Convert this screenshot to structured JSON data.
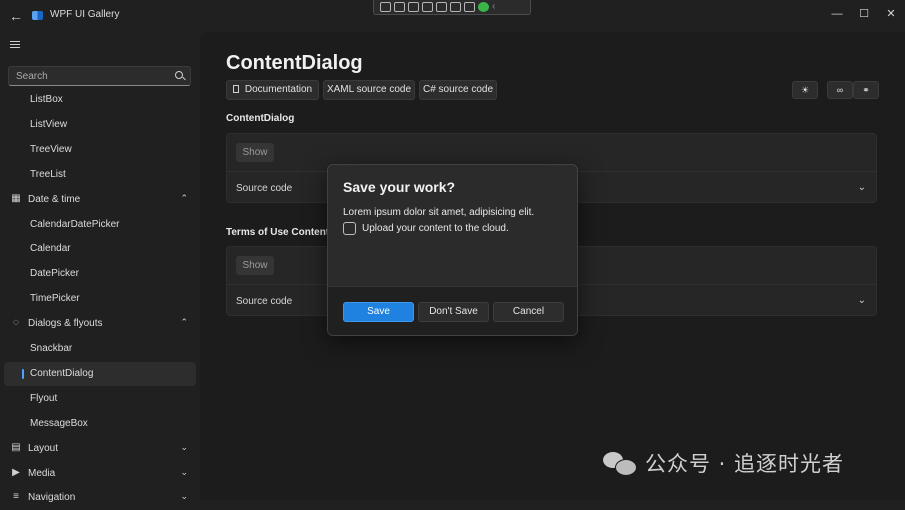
{
  "titlebar": {
    "app_title": "WPF UI Gallery",
    "back_icon": "arrow-left-icon",
    "window_controls": {
      "minimize": "—",
      "maximize": "☐",
      "close": "✕"
    }
  },
  "search": {
    "placeholder": "Search"
  },
  "nav": {
    "items": [
      {
        "label": "ListBox",
        "kind": "sub"
      },
      {
        "label": "ListView",
        "kind": "sub"
      },
      {
        "label": "TreeView",
        "kind": "sub"
      },
      {
        "label": "TreeList",
        "kind": "sub"
      },
      {
        "label": "Date & time",
        "kind": "group",
        "icon": "calendar-clock-icon",
        "chevron": "⌃"
      },
      {
        "label": "CalendarDatePicker",
        "kind": "sub"
      },
      {
        "label": "Calendar",
        "kind": "sub"
      },
      {
        "label": "DatePicker",
        "kind": "sub"
      },
      {
        "label": "TimePicker",
        "kind": "sub"
      },
      {
        "label": "Dialogs & flyouts",
        "kind": "group",
        "icon": "chat-bubble-icon",
        "chevron": "⌃"
      },
      {
        "label": "Snackbar",
        "kind": "sub"
      },
      {
        "label": "ContentDialog",
        "kind": "sub",
        "active": true
      },
      {
        "label": "Flyout",
        "kind": "sub"
      },
      {
        "label": "MessageBox",
        "kind": "sub"
      },
      {
        "label": "Layout",
        "kind": "group",
        "icon": "layout-icon",
        "chevron": "⌄"
      },
      {
        "label": "Media",
        "kind": "group",
        "icon": "play-circle-icon",
        "chevron": "⌄"
      },
      {
        "label": "Navigation",
        "kind": "group",
        "icon": "menu-lines-icon",
        "chevron": "⌄"
      }
    ]
  },
  "main": {
    "title": "ContentDialog",
    "buttons": {
      "documentation": "Documentation",
      "xaml": "XAML source code",
      "csharp": "C# source code"
    },
    "icon_buttons": {
      "theme": "☀",
      "link": "∞",
      "link2": "⚭"
    },
    "sections": [
      {
        "heading": "ContentDialog",
        "show_label": "Show",
        "source_label": "Source code",
        "chevron": "⌄"
      },
      {
        "heading": "Terms of Use ContentDialog",
        "show_label": "Show",
        "source_label": "Source code",
        "chevron": "⌄"
      }
    ]
  },
  "dialog": {
    "title": "Save your work?",
    "text": "Lorem ipsum dolor sit amet, adipisicing elit.",
    "checkbox_label": "Upload your content to the cloud.",
    "checkbox_checked": false,
    "buttons": {
      "primary": "Save",
      "secondary": "Don't Save",
      "close": "Cancel"
    },
    "accent_color": "#1f82e0"
  },
  "watermark": {
    "text": "公众号 · 追逐时光者"
  }
}
